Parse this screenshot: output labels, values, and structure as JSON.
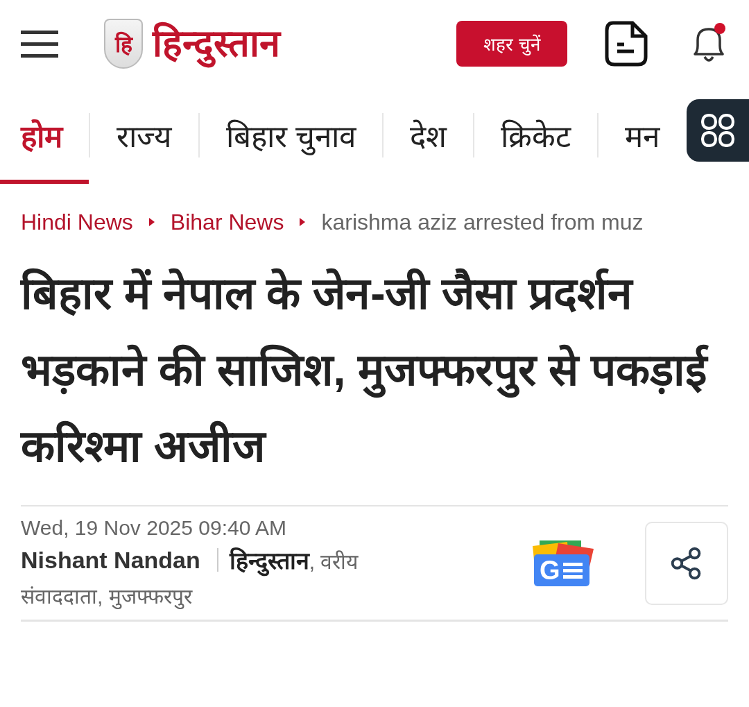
{
  "header": {
    "logo_mark": "हि",
    "logo_text": "हिन्दुस्तान",
    "city_button": "शहर चुनें",
    "notification_dot": true
  },
  "tabs": [
    {
      "label": "होम",
      "selected": true
    },
    {
      "label": "राज्य",
      "selected": false
    },
    {
      "label": "बिहार चुनाव",
      "selected": false
    },
    {
      "label": "देश",
      "selected": false
    },
    {
      "label": "क्रिकेट",
      "selected": false
    },
    {
      "label": "मन",
      "selected": false
    }
  ],
  "breadcrumb": [
    {
      "label": "Hindi News",
      "kind": "link"
    },
    {
      "label": "Bihar News",
      "kind": "link"
    },
    {
      "label": "karishma aziz arrested from muz",
      "kind": "current"
    }
  ],
  "article": {
    "headline": "बिहार में नेपाल के जेन-जी जैसा प्रदर्शन भड़काने की साजिश, मुजफ्फरपुर से पकड़ाई करिश्मा अजीज",
    "date": "Wed, 19 Nov 2025 09:40 AM",
    "author": "Nishant Nandan",
    "author_role": [
      "**हिन्दुस्तान**, वरीय",
      "संवाददाता, मुजफ्फरपुर"
    ],
    "news_badge": "G"
  }
}
